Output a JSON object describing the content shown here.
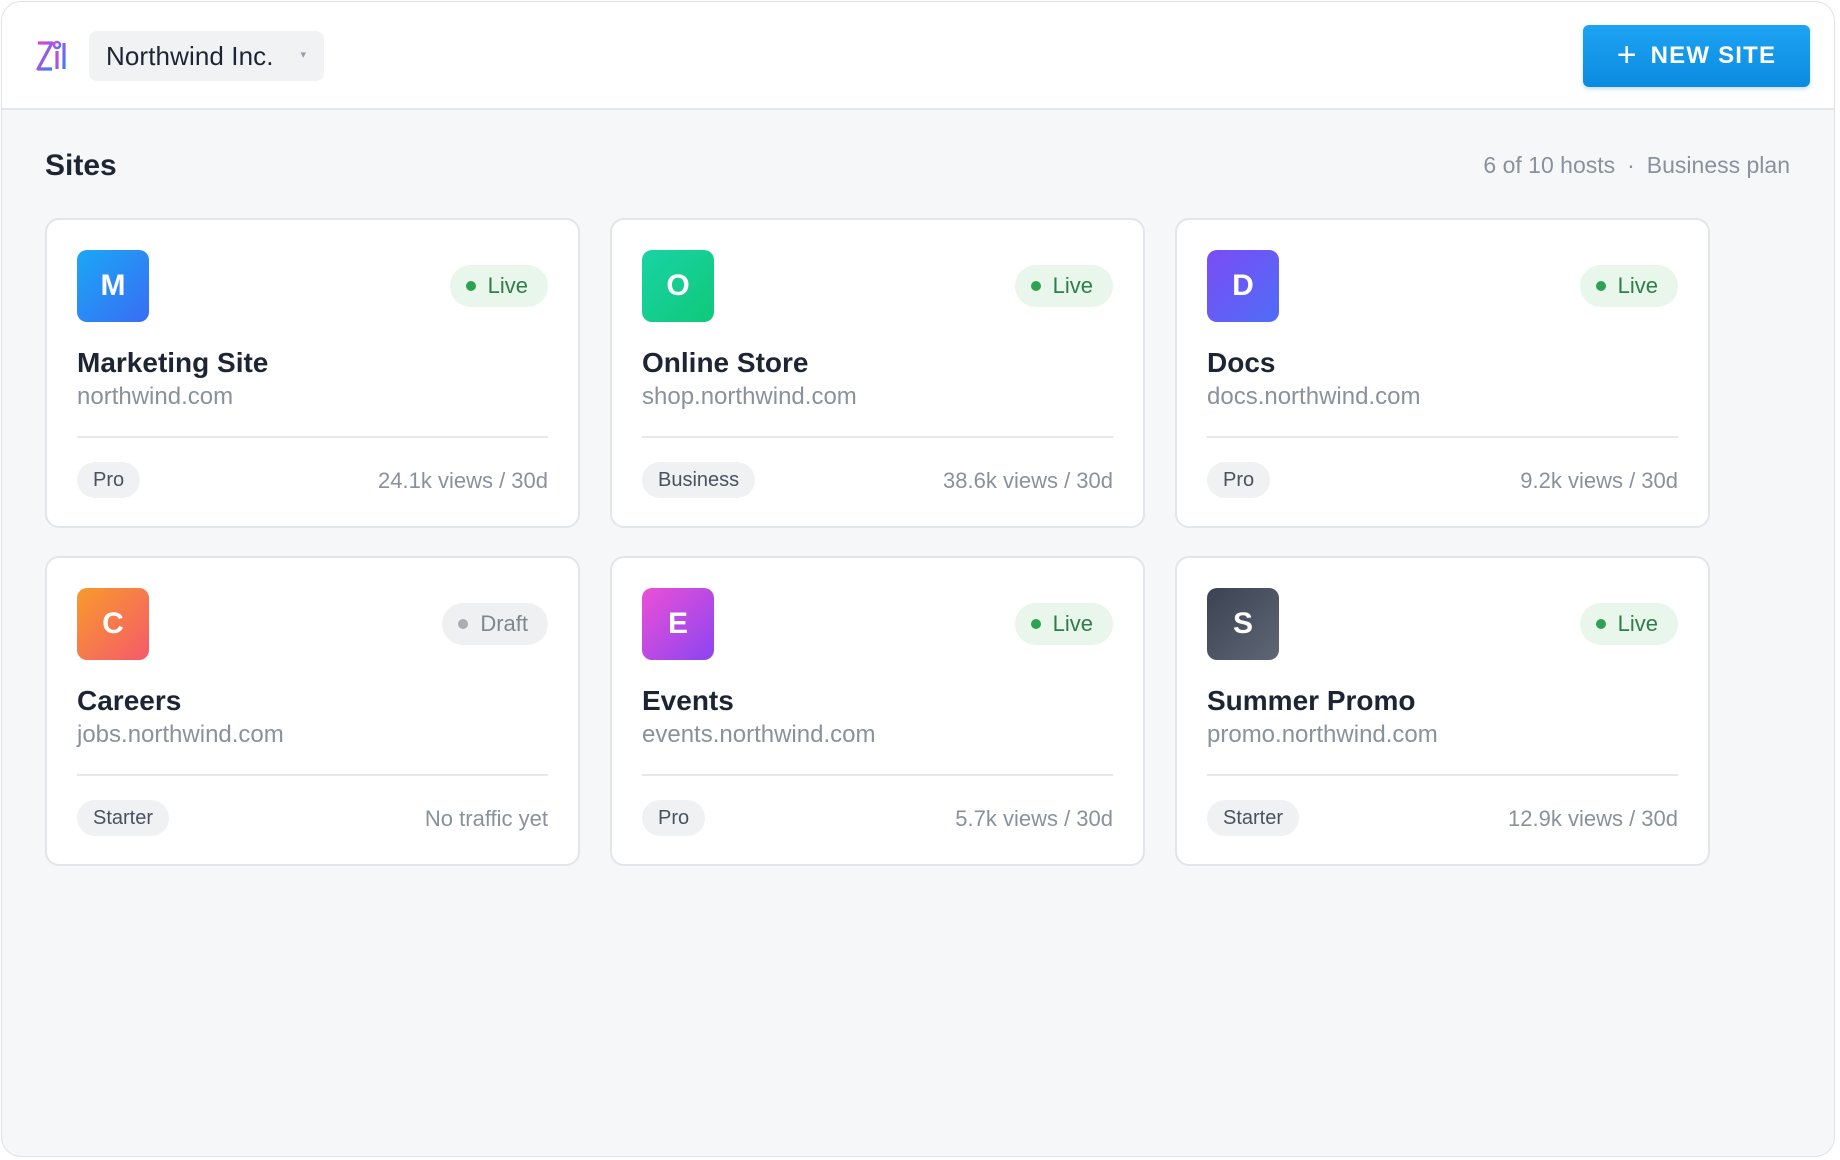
{
  "header": {
    "org_name": "Northwind Inc.",
    "org_caret": "▾",
    "new_site_icon": "+",
    "new_site_label": "NEW SITE"
  },
  "page": {
    "title": "Sites",
    "quota": "6 of 10 hosts",
    "separator": "·",
    "plan": "Business plan"
  },
  "sites": [
    {
      "initial": "M",
      "name": "Marketing Site",
      "domain": "northwind.com",
      "status": "Live",
      "plan": "Pro",
      "views": "24.1k views / 30d",
      "gradient": [
        "#1aa8f5",
        "#3a6cf5"
      ]
    },
    {
      "initial": "O",
      "name": "Online Store",
      "domain": "shop.northwind.com",
      "status": "Live",
      "plan": "Business",
      "views": "38.6k views / 30d",
      "gradient": [
        "#19d3a5",
        "#10c97a"
      ]
    },
    {
      "initial": "D",
      "name": "Docs",
      "domain": "docs.northwind.com",
      "status": "Live",
      "plan": "Pro",
      "views": "9.2k views / 30d",
      "gradient": [
        "#7b4cf5",
        "#4f6df7"
      ]
    },
    {
      "initial": "C",
      "name": "Careers",
      "domain": "jobs.northwind.com",
      "status": "Draft",
      "plan": "Starter",
      "views": "No traffic yet",
      "gradient": [
        "#f99a2c",
        "#f45a6a"
      ]
    },
    {
      "initial": "E",
      "name": "Events",
      "domain": "events.northwind.com",
      "status": "Live",
      "plan": "Pro",
      "views": "5.7k views / 30d",
      "gradient": [
        "#ec4fd6",
        "#8b45f2"
      ]
    },
    {
      "initial": "S",
      "name": "Summer Promo",
      "domain": "promo.northwind.com",
      "status": "Live",
      "plan": "Starter",
      "views": "12.9k views / 30d",
      "gradient": [
        "#3b4252",
        "#5f6777"
      ]
    }
  ]
}
